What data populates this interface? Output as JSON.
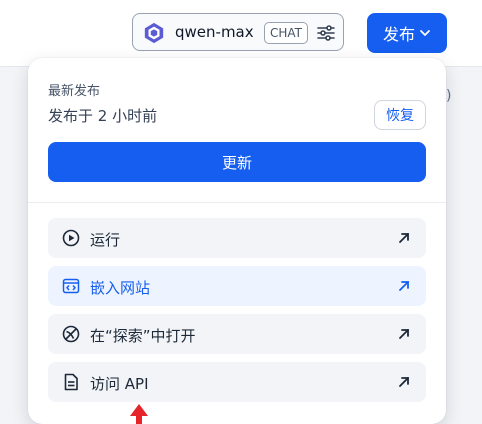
{
  "header": {
    "model_name": "qwen-max",
    "model_badge": "CHAT",
    "publish_label": "发布",
    "partial_text": ")"
  },
  "panel": {
    "section_label": "最新发布",
    "publish_time": "发布于 2 小时前",
    "restore_label": "恢复",
    "update_label": "更新",
    "actions": [
      {
        "label": "运行",
        "icon": "play-circle-icon"
      },
      {
        "label": "嵌入网站",
        "icon": "embed-window-icon"
      },
      {
        "label": "在“探索”中打开",
        "icon": "compass-icon"
      },
      {
        "label": "访问 API",
        "icon": "document-icon"
      }
    ]
  },
  "colors": {
    "primary": "#155eef",
    "highlight_bg": "#eef4ff",
    "item_bg": "#f2f4f7",
    "pointer": "#e5252a"
  }
}
